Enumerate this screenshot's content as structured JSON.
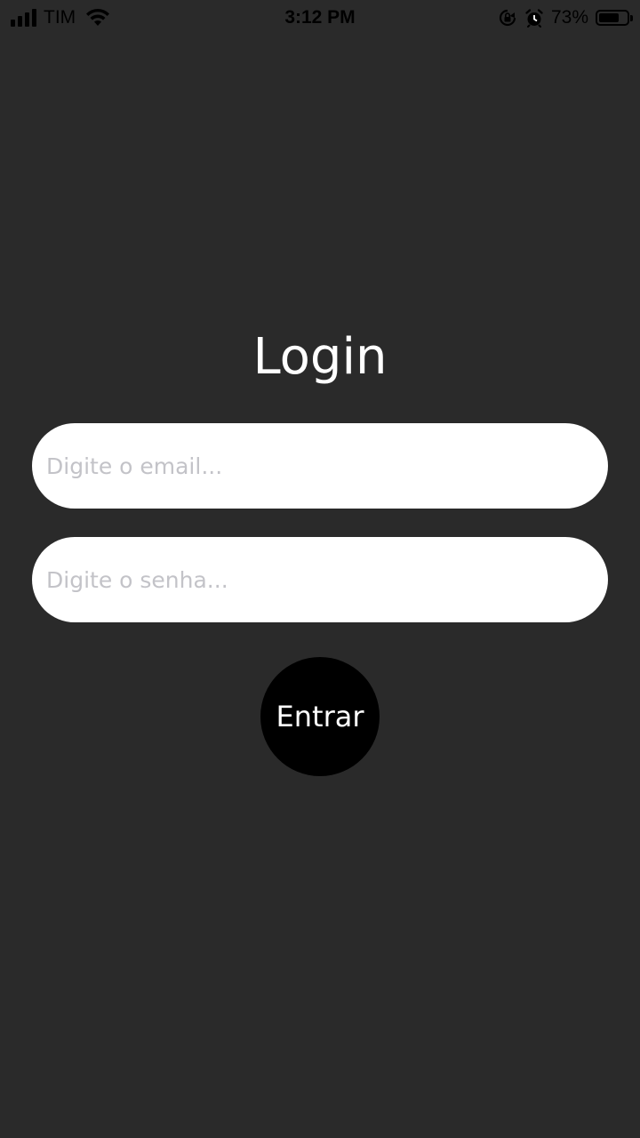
{
  "status_bar": {
    "carrier": "TIM",
    "time": "3:12 PM",
    "battery_percent_text": "73%",
    "battery_level": 0.73,
    "signal_bars": 4,
    "icons": [
      "signal-icon",
      "wifi-icon",
      "orientation-lock-icon",
      "alarm-icon",
      "battery-icon"
    ]
  },
  "login": {
    "title": "Login",
    "email_placeholder": "Digite o email...",
    "email_value": "",
    "password_placeholder": "Digite o senha...",
    "password_value": "",
    "submit_label": "Entrar"
  },
  "colors": {
    "background": "#2a2a2a",
    "field_background": "#ffffff",
    "placeholder": "#c3c3c8",
    "button_background": "#000000",
    "text_light": "#ffffff"
  }
}
